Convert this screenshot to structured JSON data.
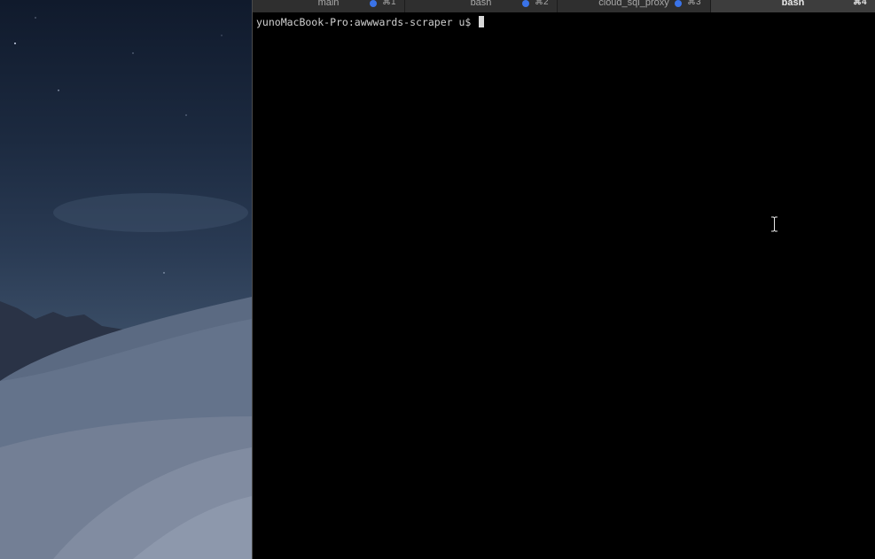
{
  "terminal": {
    "tabs": [
      {
        "label": "main",
        "shortcut": "⌘1",
        "has_activity": true,
        "active": false
      },
      {
        "label": "bash",
        "shortcut": "⌘2",
        "has_activity": true,
        "active": false
      },
      {
        "label": "cloud_sql_proxy",
        "shortcut": "⌘3",
        "has_activity": true,
        "active": false
      },
      {
        "label": "bash",
        "shortcut": "⌘4",
        "has_activity": false,
        "active": true
      }
    ],
    "prompt": "yunoMacBook-Pro:awwwards-scraper u$ "
  },
  "colors": {
    "activity_dot": "#3a73e8",
    "terminal_bg": "#000000",
    "text": "#d0d0d0"
  },
  "icons": {
    "pointer": "i-beam-cursor-icon",
    "activity": "activity-dot-icon"
  }
}
